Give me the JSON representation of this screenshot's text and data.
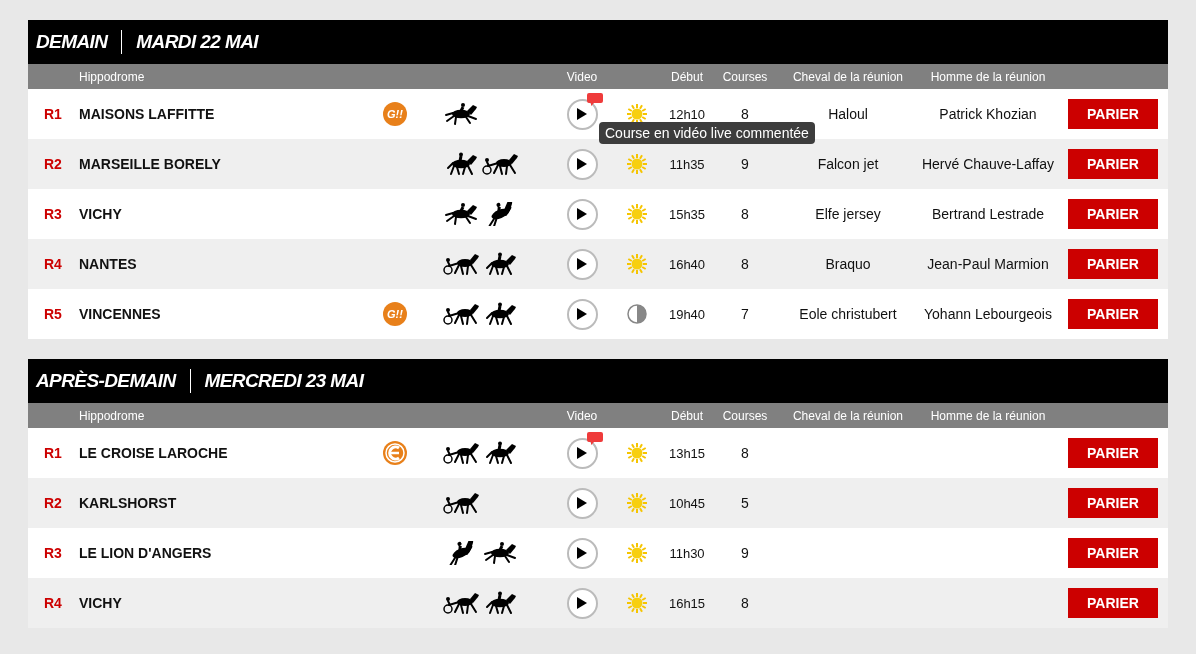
{
  "sections": [
    {
      "day": "DEMAIN",
      "date": "MARDI 22 MAI",
      "columns": [
        {
          "kind": "name",
          "label": "Hippodrome"
        },
        {
          "kind": "video",
          "label": "Video"
        },
        {
          "kind": "debut",
          "label": "Début"
        },
        {
          "kind": "courses",
          "label": "Courses"
        },
        {
          "kind": "horse",
          "label": "Cheval de la réunion"
        },
        {
          "kind": "man",
          "label": "Homme de la réunion"
        }
      ],
      "rows": [
        {
          "num": "R1",
          "name": "MAISONS LAFFITTE",
          "badge": {
            "kind": "g",
            "label": "G!!"
          },
          "disciplines": [
            {
              "kind": "plat"
            }
          ],
          "live": true,
          "tooltip": "Course en vidéo live commentée",
          "weather": {
            "kind": "sun"
          },
          "time": "12h10",
          "courses": "8",
          "horse": "Haloul",
          "man": "Patrick Khozian",
          "button": "PARIER"
        },
        {
          "num": "R2",
          "name": "MARSEILLE BORELY",
          "disciplines": [
            {
              "kind": "monte"
            },
            {
              "kind": "attele"
            }
          ],
          "live": false,
          "weather": {
            "kind": "sun"
          },
          "time": "11h35",
          "courses": "9",
          "horse": "Falcon jet",
          "man": "Hervé Chauve-Laffay",
          "button": "PARIER"
        },
        {
          "num": "R3",
          "name": "VICHY",
          "disciplines": [
            {
              "kind": "plat"
            },
            {
              "kind": "obstacle"
            }
          ],
          "live": false,
          "weather": {
            "kind": "sun"
          },
          "time": "15h35",
          "courses": "8",
          "horse": "Elfe jersey",
          "man": "Bertrand Lestrade",
          "button": "PARIER"
        },
        {
          "num": "R4",
          "name": "NANTES",
          "disciplines": [
            {
              "kind": "attele"
            },
            {
              "kind": "monte"
            }
          ],
          "live": false,
          "weather": {
            "kind": "sun"
          },
          "time": "16h40",
          "courses": "8",
          "horse": "Braquo",
          "man": "Jean-Paul Marmion",
          "button": "PARIER"
        },
        {
          "num": "R5",
          "name": "VINCENNES",
          "badge": {
            "kind": "g",
            "label": "G!!"
          },
          "disciplines": [
            {
              "kind": "attele"
            },
            {
              "kind": "monte"
            }
          ],
          "live": false,
          "weather": {
            "kind": "night"
          },
          "time": "19h40",
          "courses": "7",
          "horse": "Eole christubert",
          "man": "Yohann Lebourgeois",
          "button": "PARIER"
        }
      ]
    },
    {
      "day": "APRÈS-DEMAIN",
      "date": "MERCREDI 23 MAI",
      "columns": [
        {
          "kind": "name",
          "label": "Hippodrome"
        },
        {
          "kind": "video",
          "label": "Video"
        },
        {
          "kind": "debut",
          "label": "Début"
        },
        {
          "kind": "courses",
          "label": "Courses"
        },
        {
          "kind": "horse",
          "label": "Cheval de la réunion"
        },
        {
          "kind": "man",
          "label": "Homme de la réunion"
        }
      ],
      "rows": [
        {
          "num": "R1",
          "name": "LE CROISE LAROCHE",
          "badge": {
            "kind": "e"
          },
          "disciplines": [
            {
              "kind": "attele"
            },
            {
              "kind": "monte"
            }
          ],
          "live": true,
          "weather": {
            "kind": "sun"
          },
          "time": "13h15",
          "courses": "8",
          "button": "PARIER"
        },
        {
          "num": "R2",
          "name": "KARLSHORST",
          "disciplines": [
            {
              "kind": "attele"
            }
          ],
          "live": false,
          "weather": {
            "kind": "sun"
          },
          "time": "10h45",
          "courses": "5",
          "button": "PARIER"
        },
        {
          "num": "R3",
          "name": "LE LION D'ANGERS",
          "disciplines": [
            {
              "kind": "obstacle"
            },
            {
              "kind": "plat"
            }
          ],
          "live": false,
          "weather": {
            "kind": "sun"
          },
          "time": "11h30",
          "courses": "9",
          "button": "PARIER"
        },
        {
          "num": "R4",
          "name": "VICHY",
          "disciplines": [
            {
              "kind": "attele"
            },
            {
              "kind": "monte"
            }
          ],
          "live": false,
          "weather": {
            "kind": "sun"
          },
          "time": "16h15",
          "courses": "8",
          "button": "PARIER"
        }
      ]
    }
  ]
}
